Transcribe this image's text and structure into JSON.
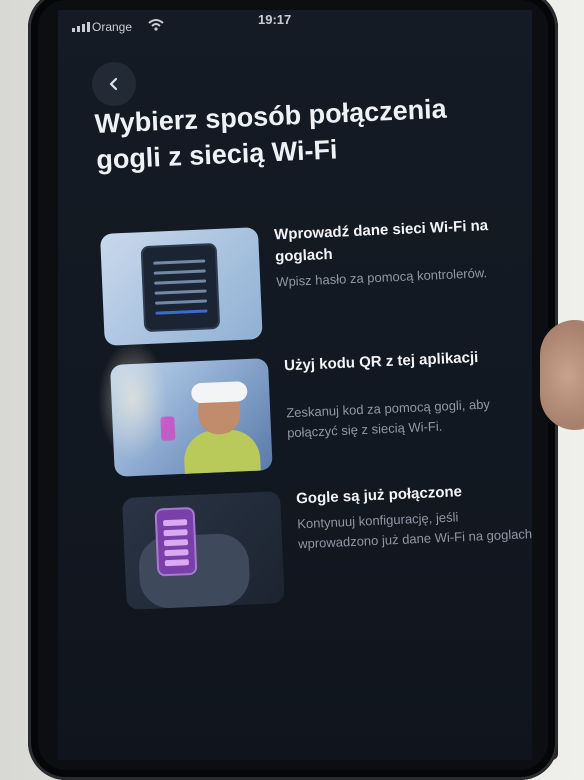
{
  "status_bar": {
    "carrier": "Orange",
    "time": "19:17"
  },
  "header": {
    "title": "Wybierz sposób połączenia gogli z siecią Wi-Fi"
  },
  "options": [
    {
      "title": "Wprowadź dane sieci Wi-Fi na goglach",
      "description": "Wpisz hasło za pomocą kontrolerów."
    },
    {
      "title": "Użyj kodu QR z tej aplikacji",
      "description": "Zeskanuj kod za pomocą gogli, aby połączyć się z siecią Wi-Fi."
    },
    {
      "title": "Gogle są już połączone",
      "description": "Kontynuuj konfigurację, jeśli wprowadzono już dane Wi-Fi na goglach."
    }
  ],
  "icons": {
    "back": "chevron-left-icon",
    "wifi": "wifi-icon",
    "signal": "signal-icon"
  }
}
